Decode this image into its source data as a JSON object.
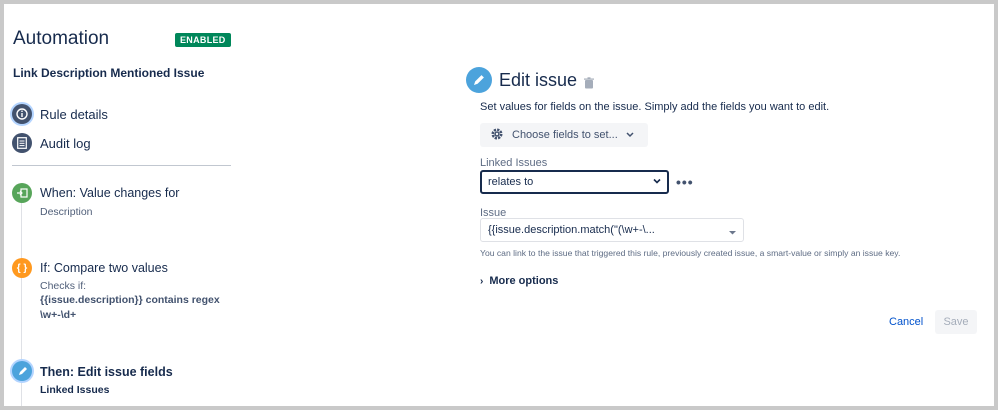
{
  "header": {
    "title": "Automation",
    "status_badge": "ENABLED"
  },
  "rule": {
    "name": "Link Description Mentioned Issue"
  },
  "sidebar": {
    "items": [
      {
        "label": "Rule details",
        "icon": "info-icon"
      },
      {
        "label": "Audit log",
        "icon": "document-icon"
      }
    ]
  },
  "steps": {
    "trigger": {
      "title": "When: Value changes for",
      "detail": "Description",
      "color": "#57a55a"
    },
    "condition": {
      "title": "If: Compare two values",
      "detail": "Checks if:",
      "expr1": "{{issue.description}} contains regex",
      "expr2": "\\w+-\\d+",
      "color": "#ff991f"
    },
    "action": {
      "title": "Then: Edit issue fields",
      "detail": "Linked Issues",
      "color": "#4ca3dc"
    }
  },
  "panel": {
    "title": "Edit issue",
    "description": "Set values for fields on the issue. Simply add the fields you want to edit.",
    "choose_fields": "Choose fields to set...",
    "linked_label": "Linked Issues",
    "linked_value": "relates to",
    "more": "•••",
    "issue_label": "Issue",
    "issue_value": "{{issue.description.match(\"(\\w+-\\...",
    "helper": "You can link to the issue that triggered this rule, previously created issue, a smart-value or simply an issue key.",
    "more_options": "More options",
    "cancel": "Cancel",
    "save": "Save"
  },
  "colors": {
    "accent": "#0052cc",
    "enabled": "#00875a"
  }
}
